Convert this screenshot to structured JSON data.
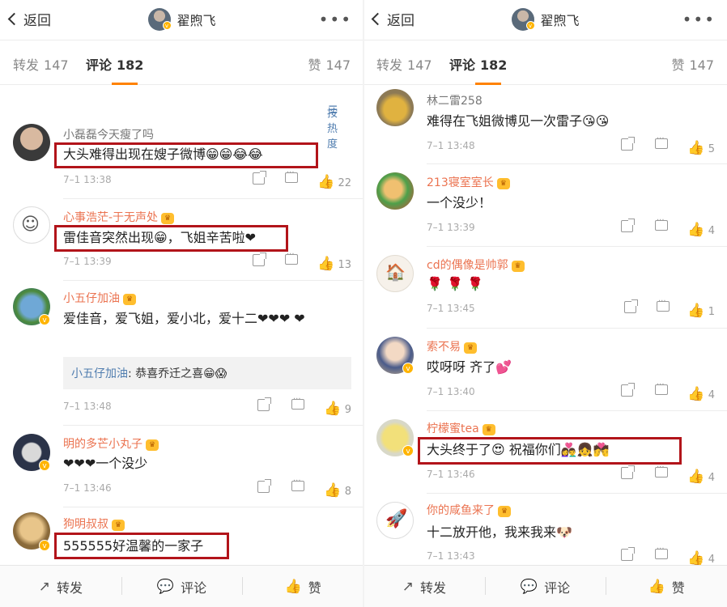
{
  "header": {
    "back_label": "返回",
    "title": "翟煦飞",
    "more_icon": "more-dots-icon"
  },
  "tabs": {
    "repost": "转发",
    "repost_count": "147",
    "comment": "评论",
    "comment_count": "182",
    "like": "赞",
    "like_count": "147"
  },
  "sort_label": "按热度",
  "left_comments": [
    {
      "name": "小磊磊今天瘦了吗",
      "text": "大头难得出现在嫂子微博😁😁😂😂",
      "time": "7–1 13:38",
      "likes": "22"
    },
    {
      "name": "心事浩茫-于无声处",
      "text": "雷佳音突然出现😁，飞姐辛苦啦❤",
      "time": "7–1 13:39",
      "likes": "13"
    },
    {
      "name": "小五仔加油",
      "text": "爱佳音，爱飞姐，爱小北，爱十二❤❤❤ ❤",
      "reply_name": "小五仔加油",
      "reply_text": ": 恭喜乔迁之喜😁😱",
      "time": "7–1 13:48",
      "likes": "9"
    },
    {
      "name": "明的多芒小丸子",
      "text": "❤❤❤一个没少",
      "time": "7–1 13:46",
      "likes": "8"
    },
    {
      "name": "狗明叔叔",
      "text": "555555好温馨的一家子"
    }
  ],
  "right_comments": [
    {
      "name": "林二雷258",
      "text": "难得在飞姐微博见一次雷子😘😘",
      "time": "7–1 13:48",
      "likes": "5"
    },
    {
      "name": "213寝室室长",
      "text": "一个没少！",
      "time": "7–1 13:39",
      "likes": "4"
    },
    {
      "name": "cd的偶像是帅郭",
      "text": "🌹 🌹 🌹",
      "time": "7–1 13:45",
      "likes": "1"
    },
    {
      "name": "索不易",
      "text": "哎呀呀 齐了💕",
      "time": "7–1 13:40",
      "likes": "4"
    },
    {
      "name": "柠檬蜜tea",
      "text": "大头终于了😍  祝福你们👩‍❤‍👨👧💏",
      "time": "7–1 13:46",
      "likes": "4"
    },
    {
      "name": "你的咸鱼来了",
      "text": "十二放开他，我来我来🐶",
      "time": "7–1 13:43",
      "likes": "4"
    }
  ],
  "bottom_bar": {
    "repost": "转发",
    "comment": "评论",
    "like": "赞"
  },
  "colors": {
    "accent": "#ff8200",
    "username": "#eb7350",
    "link": "#507daf",
    "highlight_box": "#b2141a"
  }
}
